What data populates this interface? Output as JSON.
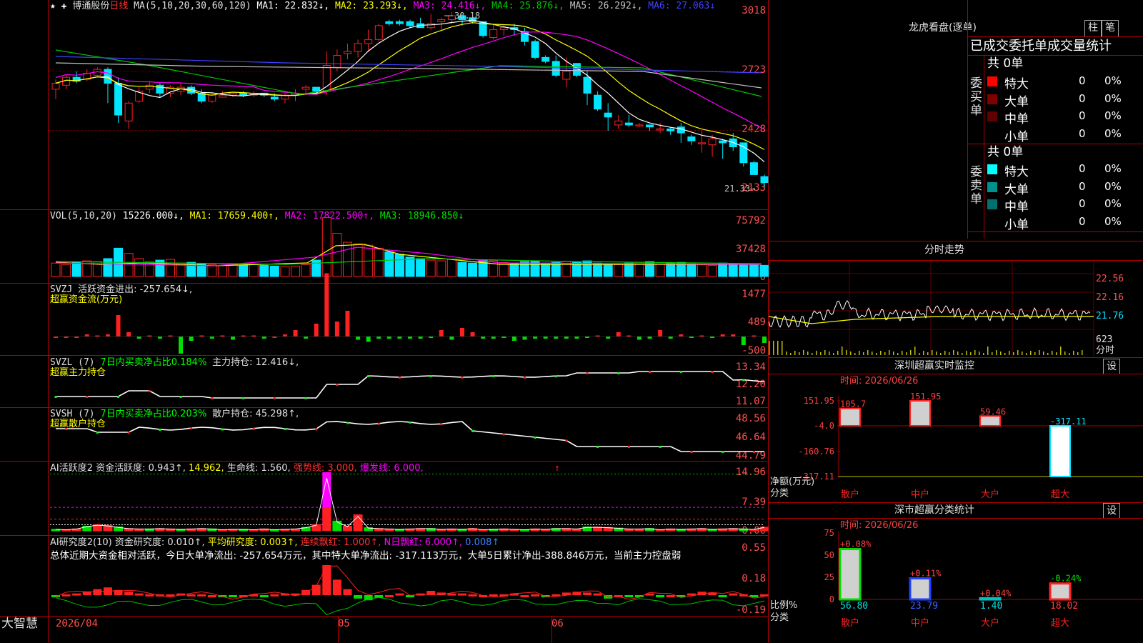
{
  "colors": {
    "up": "#ff2020",
    "down": "#00e5ff",
    "grid": "#b00000",
    "ma1": "#ffffff",
    "ma2": "#ffff00",
    "ma3": "#ff00ff",
    "ma4": "#00c800",
    "ma5": "#c0c0c0",
    "ma6": "#4040ff"
  },
  "main": {
    "stock": "博通股份",
    "period": "日线",
    "ma_label": "MA(5,10,20,30,60,120)",
    "ma": [
      {
        "text": "MA1: 22.832↓,",
        "color": "#ffffff"
      },
      {
        "text": "MA2: 23.293↓,",
        "color": "#ffff00"
      },
      {
        "text": "MA3: 24.416↓,",
        "color": "#ff00ff"
      },
      {
        "text": "MA4: 25.876↓,",
        "color": "#00c800"
      },
      {
        "text": "MA5: 26.292↓,",
        "color": "#c0c0c0"
      },
      {
        "text": "MA6: 27.063↓",
        "color": "#4040ff"
      }
    ],
    "yticks": [
      "3018",
      "2723",
      "2428",
      "2133"
    ],
    "high_label": "30.18",
    "low_label": "21.33"
  },
  "vol": {
    "label": "VOL(5,10,20)",
    "value": "15226.000↓,",
    "ma1": "MA1: 17659.400↑,",
    "ma2": "MA2: 17822.500↑,",
    "ma3": "MA3: 18946.850↓",
    "yticks": [
      "75792",
      "37428",
      "0"
    ]
  },
  "svzj": {
    "label": "SVZJ",
    "desc": "活跃资金进出: -257.654↓,",
    "sub": "超赢资金流(万元)",
    "yticks": [
      "1477",
      "489",
      "-500"
    ]
  },
  "svzl": {
    "label": "SVZL (7)",
    "desc": "7日内买卖净占比0.184%",
    "desc2": "主力持仓: 12.416↓,",
    "sub": "超赢主力持仓",
    "yticks": [
      "13.34",
      "12.20",
      "11.07"
    ]
  },
  "svsh": {
    "label": "SVSH (7)",
    "desc": "7日内买卖净占比0.203%",
    "desc2": "散户持仓: 45.298↑,",
    "sub": "超赢散户持仓",
    "yticks": [
      "48.56",
      "46.64",
      "44.79"
    ]
  },
  "ai1": {
    "label": "AI活跃度2",
    "desc": "资金活跃度: 0.943↑,",
    "v2": "14.962,",
    "v3": "生命线: 1.560,",
    "v4": "强势线: 3.000,",
    "v5": "爆发线: 6.000,",
    "yticks": [
      "14.96",
      "7.39",
      "0.00"
    ]
  },
  "ai2": {
    "label": "AI研究度2(10)",
    "desc": "资金研究度: 0.010↑,",
    "v2": "平均研究度: 0.003↑,",
    "v3": "连续飘红: 1.000↑,",
    "v4": "N日飘红: 6.000↑,",
    "v5": "0.008↑",
    "summary": "总体近期大资金相对活跃，今日大单净流出: -257.654万元，其中特大单净流出: -317.113万元，大单5日累计净出-388.846万元，当前主力控盘弱",
    "yticks": [
      "0.55",
      "0.18",
      "-0.19"
    ]
  },
  "footer": {
    "brand": "大智慧",
    "date1": "2026/04",
    "date2": "05",
    "date3": "06"
  },
  "right": {
    "lhb": {
      "title": "龙虎看盘(逐单)",
      "btn1": "柱",
      "btn2": "笔",
      "subtitle": "已成交委托单成交量统计",
      "buy": {
        "side": "委买单",
        "total": "共 0单",
        "rows": [
          {
            "name": "特大",
            "v": "0",
            "p": "0%",
            "c": "#ff0000"
          },
          {
            "name": "大单",
            "v": "0",
            "p": "0%",
            "c": "#800000"
          },
          {
            "name": "中单",
            "v": "0",
            "p": "0%",
            "c": "#600000"
          },
          {
            "name": "小单",
            "v": "0",
            "p": "0%",
            "c": "#000000"
          }
        ]
      },
      "sell": {
        "side": "委卖单",
        "total": "共 0单",
        "rows": [
          {
            "name": "特大",
            "v": "0",
            "p": "0%",
            "c": "#00ffff"
          },
          {
            "name": "大单",
            "v": "0",
            "p": "0%",
            "c": "#009090"
          },
          {
            "name": "中单",
            "v": "0",
            "p": "0%",
            "c": "#007070"
          },
          {
            "name": "小单",
            "v": "0",
            "p": "0%",
            "c": "#000000"
          }
        ]
      }
    },
    "fs": {
      "title": "分时走势",
      "y1": "22.56",
      "y2": "22.16",
      "y3": "21.76",
      "vol": "623",
      "vol2": "分时"
    },
    "sz": {
      "title": "深圳超赢实时监控",
      "btn": "设",
      "time": "时间: 2026/06/26",
      "yticks": [
        "151.95",
        "-4.0",
        "-160.76",
        "-317.11"
      ],
      "ylab": "净额(万元)",
      "xlab": "分类",
      "bars": [
        {
          "cat": "散户",
          "v": 105.7,
          "label": "105.7"
        },
        {
          "cat": "中户",
          "v": 151.95,
          "label": "151.95"
        },
        {
          "cat": "大户",
          "v": 59.46,
          "label": "59.46"
        },
        {
          "cat": "超大",
          "v": -317.11,
          "label": "-317.11"
        }
      ]
    },
    "cls": {
      "title": "深市超赢分类统计",
      "btn": "设",
      "time": "时间: 2026/06/26",
      "yticks": [
        "75",
        "50",
        "25",
        "0"
      ],
      "ylab": "比例%",
      "xlab": "分类",
      "bars": [
        {
          "cat": "散户",
          "v": 56.8,
          "label": "56.80",
          "chg": "+0.08%",
          "c": "#00e000"
        },
        {
          "cat": "中户",
          "v": 23.79,
          "label": "23.79",
          "chg": "+0.11%",
          "c": "#2040ff"
        },
        {
          "cat": "大户",
          "v": 1.4,
          "label": "1.40",
          "chg": "+0.04%",
          "c": "#00c0c0"
        },
        {
          "cat": "超大",
          "v": 18.02,
          "label": "18.02",
          "chg": "-0.24%",
          "c": "#ff2020"
        }
      ]
    }
  },
  "chart_data": {
    "type": "candlestick",
    "ohlc": [
      [
        26.3,
        26.8,
        25.8,
        26.6
      ],
      [
        26.5,
        27.0,
        26.3,
        26.9
      ],
      [
        26.9,
        27.2,
        26.6,
        26.7
      ],
      [
        26.8,
        27.3,
        26.7,
        27.1
      ],
      [
        27.0,
        27.4,
        26.9,
        27.3
      ],
      [
        27.3,
        27.4,
        25.6,
        26.6
      ],
      [
        26.6,
        26.9,
        24.6,
        25.0
      ],
      [
        24.7,
        25.7,
        24.3,
        25.6
      ],
      [
        25.7,
        26.4,
        25.6,
        26.2
      ],
      [
        26.3,
        26.7,
        26.1,
        26.5
      ],
      [
        26.5,
        26.6,
        25.9,
        26.1
      ],
      [
        26.1,
        26.5,
        25.9,
        26.4
      ],
      [
        26.2,
        26.6,
        26.0,
        26.4
      ],
      [
        26.4,
        26.5,
        26.0,
        26.1
      ],
      [
        26.1,
        26.3,
        25.6,
        25.7
      ],
      [
        25.7,
        26.1,
        25.6,
        26.0
      ],
      [
        25.9,
        26.2,
        25.9,
        26.0
      ],
      [
        26.0,
        26.1,
        25.9,
        26.1
      ],
      [
        26.1,
        26.2,
        25.9,
        26.0
      ],
      [
        26.0,
        26.2,
        25.9,
        26.1
      ],
      [
        26.1,
        26.1,
        25.9,
        26.0
      ],
      [
        25.9,
        26.1,
        25.7,
        25.8
      ],
      [
        25.8,
        26.1,
        25.6,
        26.0
      ],
      [
        26.0,
        26.3,
        25.7,
        26.1
      ],
      [
        26.3,
        26.5,
        26.0,
        26.4
      ],
      [
        26.4,
        26.4,
        26.1,
        26.2
      ],
      [
        26.2,
        28.2,
        26.0,
        27.5
      ],
      [
        27.4,
        28.3,
        27.2,
        28.0
      ],
      [
        28.1,
        28.6,
        27.8,
        28.2
      ],
      [
        28.2,
        28.8,
        27.9,
        28.6
      ],
      [
        28.6,
        29.3,
        28.2,
        28.8
      ],
      [
        28.8,
        29.6,
        28.7,
        29.5
      ],
      [
        29.7,
        29.8,
        29.5,
        29.6
      ],
      [
        29.7,
        29.8,
        29.5,
        29.6
      ],
      [
        29.7,
        29.8,
        29.4,
        29.5
      ],
      [
        29.6,
        29.9,
        29.4,
        29.4
      ],
      [
        29.4,
        30.1,
        29.3,
        29.6
      ],
      [
        29.7,
        29.9,
        29.3,
        29.8
      ],
      [
        29.8,
        30.18,
        29.6,
        30.0
      ],
      [
        30.0,
        30.1,
        29.5,
        29.8
      ],
      [
        29.9,
        30.0,
        29.6,
        29.7
      ],
      [
        29.7,
        29.7,
        28.9,
        29.0
      ],
      [
        28.9,
        29.6,
        28.8,
        29.3
      ],
      [
        29.3,
        29.5,
        29.0,
        29.4
      ],
      [
        29.4,
        29.6,
        29.0,
        29.3
      ],
      [
        29.2,
        29.4,
        28.5,
        28.7
      ],
      [
        28.7,
        28.8,
        27.8,
        27.9
      ],
      [
        27.9,
        28.0,
        27.6,
        27.7
      ],
      [
        27.7,
        28.0,
        26.9,
        27.0
      ],
      [
        26.8,
        27.9,
        26.4,
        27.2
      ],
      [
        27.6,
        27.6,
        26.9,
        27.0
      ],
      [
        26.9,
        27.2,
        25.5,
        26.1
      ],
      [
        26.0,
        26.2,
        25.2,
        25.3
      ],
      [
        25.1,
        25.6,
        24.2,
        24.9
      ],
      [
        24.5,
        25.0,
        24.3,
        24.7
      ],
      [
        24.6,
        25.0,
        24.4,
        24.5
      ],
      [
        24.5,
        24.6,
        24.4,
        24.5
      ],
      [
        24.5,
        24.5,
        24.2,
        24.4
      ],
      [
        24.3,
        24.6,
        24.1,
        24.3
      ],
      [
        24.3,
        24.4,
        24.0,
        24.2
      ],
      [
        24.4,
        24.6,
        23.6,
        24.1
      ],
      [
        23.9,
        24.0,
        23.5,
        23.7
      ],
      [
        23.6,
        24.2,
        23.1,
        23.6
      ],
      [
        23.5,
        24.0,
        22.9,
        23.8
      ],
      [
        23.7,
        23.8,
        22.8,
        23.6
      ],
      [
        23.8,
        24.1,
        23.2,
        23.4
      ],
      [
        23.6,
        23.6,
        22.4,
        22.6
      ],
      [
        22.6,
        22.7,
        22.1,
        22.0
      ],
      [
        21.9,
        22.0,
        21.33,
        21.6
      ]
    ],
    "ylim": [
      21.33,
      30.5
    ]
  }
}
